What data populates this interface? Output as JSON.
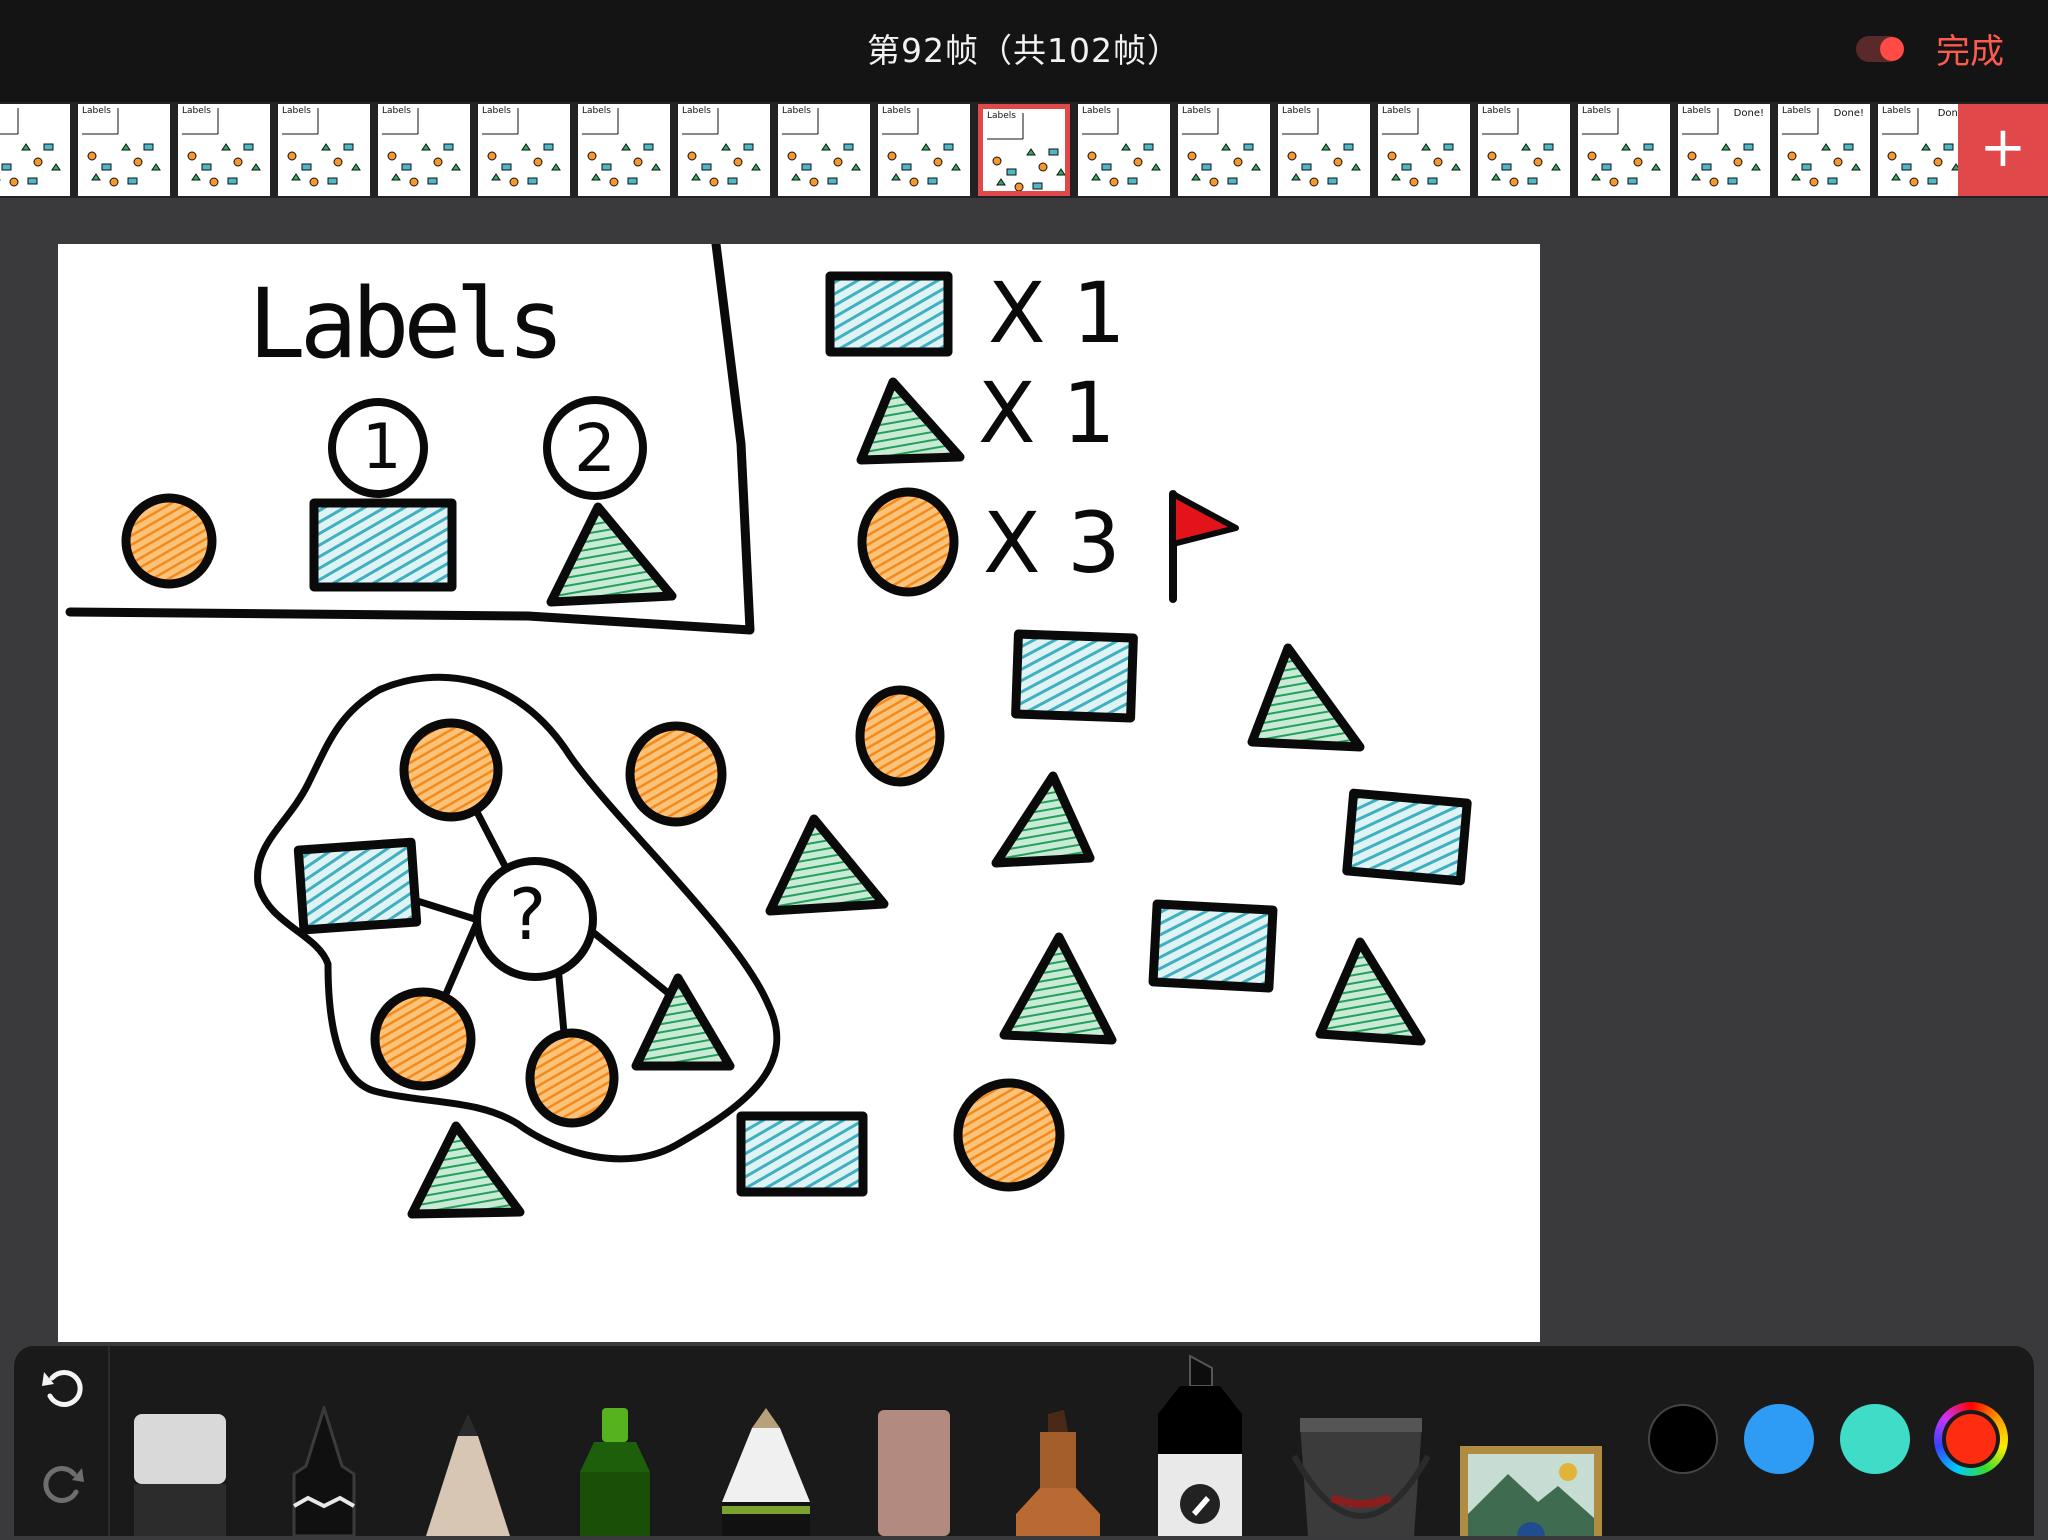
{
  "header": {
    "frame_title": "第92帧（共102帧）",
    "done_label": "完成"
  },
  "filmstrip": {
    "add_label": "+",
    "thumbnails": [
      {
        "label": "",
        "overlay": ""
      },
      {
        "label": "Labels",
        "overlay": ""
      },
      {
        "label": "Labels",
        "overlay": ""
      },
      {
        "label": "Labels",
        "overlay": ""
      },
      {
        "label": "Labels",
        "overlay": ""
      },
      {
        "label": "Labels",
        "overlay": ""
      },
      {
        "label": "Labels",
        "overlay": ""
      },
      {
        "label": "Labels",
        "overlay": ""
      },
      {
        "label": "Labels",
        "overlay": ""
      },
      {
        "label": "Labels",
        "overlay": ""
      },
      {
        "label": "Labels",
        "overlay": ""
      },
      {
        "label": "Labels",
        "overlay": ""
      },
      {
        "label": "Labels",
        "overlay": ""
      },
      {
        "label": "Labels",
        "overlay": ""
      },
      {
        "label": "Labels",
        "overlay": ""
      },
      {
        "label": "Labels",
        "overlay": ""
      },
      {
        "label": "Labels",
        "overlay": ""
      },
      {
        "label": "Labels",
        "overlay": "Done!"
      },
      {
        "label": "Labels",
        "overlay": "Done!"
      },
      {
        "label": "Labels",
        "overlay": "Done"
      }
    ],
    "active_index": 10
  },
  "canvas": {
    "heading": "Labels",
    "label_one": "1",
    "label_two": "2",
    "count_rect": "X 1",
    "count_triangle": "X 1",
    "count_circle": "X 3",
    "question": "?"
  },
  "tools": [
    {
      "name": "eraser-tool",
      "icon": "eraser-icon"
    },
    {
      "name": "pen-tool",
      "icon": "pen-icon"
    },
    {
      "name": "pencil-tool",
      "icon": "pencil-icon"
    },
    {
      "name": "marker-tool",
      "icon": "marker-icon"
    },
    {
      "name": "crayon-tool",
      "icon": "crayon-icon"
    },
    {
      "name": "brush-tool",
      "icon": "brush-icon"
    },
    {
      "name": "smudge-tool",
      "icon": "smudge-icon"
    },
    {
      "name": "ink-tool",
      "icon": "ink-icon"
    },
    {
      "name": "fill-tool",
      "icon": "bucket-icon"
    },
    {
      "name": "image-tool",
      "icon": "image-icon"
    }
  ],
  "colors": {
    "accent": "#e0484a",
    "swatches": [
      "#000000",
      "#2e9cf5",
      "#3fdcc8",
      "#ff2d10"
    ],
    "orange": "#f7962d",
    "teal": "#4fb8c6",
    "green": "#2fa866",
    "flag": "#e2141a"
  }
}
